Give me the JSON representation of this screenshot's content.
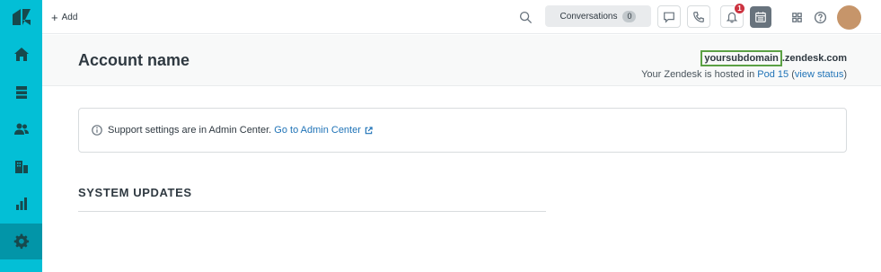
{
  "topbar": {
    "add_label": "Add",
    "conversations_label": "Conversations",
    "conversations_count": "0",
    "notifications_count": "1"
  },
  "header": {
    "title": "Account name",
    "subdomain": "yoursubdomain",
    "domain_suffix": ".zendesk.com",
    "hosted_prefix": "Your Zendesk is hosted in ",
    "pod_link": "Pod 15",
    "status_link": "view status"
  },
  "notice": {
    "text": "Support settings are in Admin Center.",
    "link": "Go to Admin Center"
  },
  "system_updates": {
    "title": "SYSTEM UPDATES"
  },
  "sidebar": {
    "items": [
      "zendesk-logo",
      "home-icon",
      "views-icon",
      "customers-icon",
      "organizations-icon",
      "reporting-icon",
      "admin-gear-icon"
    ]
  },
  "colors": {
    "sidebar": "#03bfd6",
    "sidebar_active": "#0295a8",
    "link": "#1f73b7",
    "highlight_border": "#5ba144",
    "badge": "#cc3340"
  }
}
